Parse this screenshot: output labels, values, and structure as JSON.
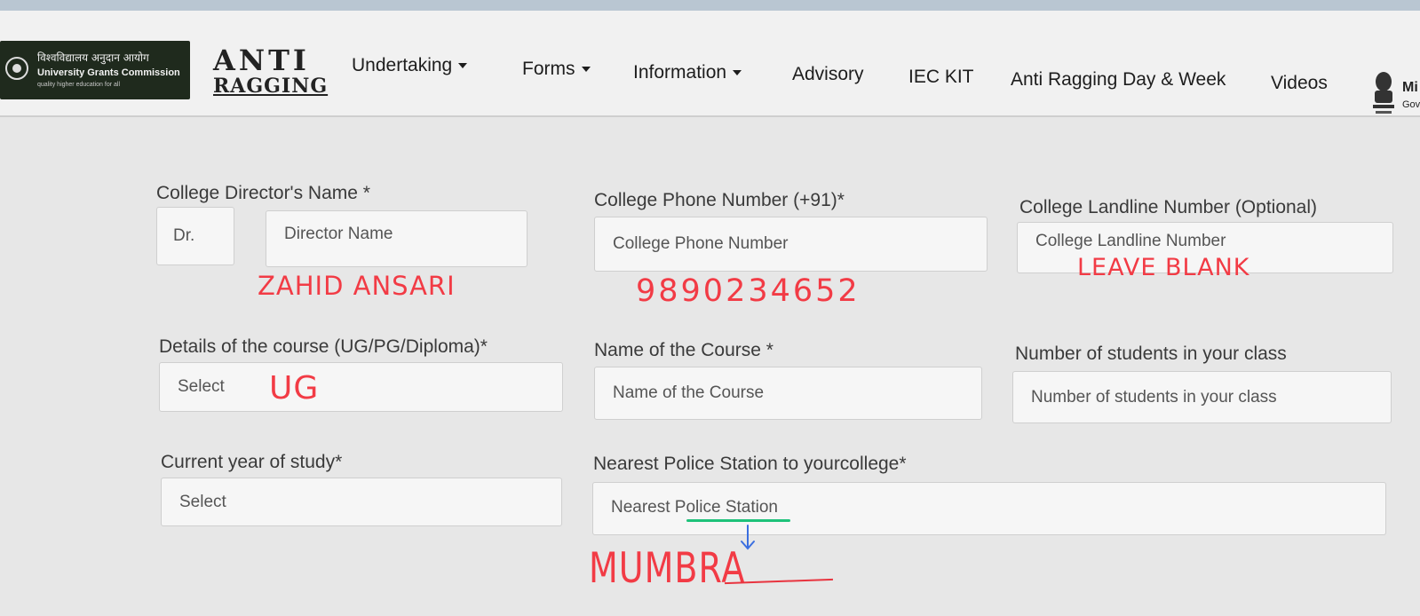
{
  "brand": {
    "ugc_hindi": "विश्वविद्यालय अनुदान आयोग",
    "ugc_name": "University Grants Commission",
    "ugc_tagline": "quality higher education for all",
    "anti": "ANTI",
    "ragging": "RAGGING"
  },
  "nav": {
    "items": [
      "Undertaking",
      "Forms",
      "Information",
      "Advisory",
      "IEC KIT",
      "Anti Ragging Day & Week",
      "Videos"
    ],
    "emblem_text": "Mi",
    "emblem_text2": "Gov"
  },
  "form": {
    "director_label": "College Director's Name *",
    "director_prefix": "Dr.",
    "director_placeholder": "Director Name",
    "phone_label": "College Phone Number (+91)*",
    "phone_placeholder": "College Phone Number",
    "landline_label": "College Landline Number (Optional)",
    "landline_placeholder": "College Landline Number",
    "course_details_label": "Details of the course (UG/PG/Diploma)*",
    "course_details_value": "Select",
    "course_name_label": "Name of the Course *",
    "course_name_placeholder": "Name of the Course",
    "students_label": "Number of students in your class",
    "students_placeholder": "Number of students in your class",
    "year_label": "Current year of study*",
    "year_value": "Select",
    "police_label": "Nearest Police Station to yourcollege*",
    "police_placeholder": "Nearest Police Station"
  },
  "annotations": {
    "director_name": "ZAHID ANSARI",
    "phone": "9890234652",
    "landline": "LEAVE BLANK",
    "course": "UG",
    "police": "MUMBRA"
  },
  "colors": {
    "handwriting": "#f23b45",
    "highlight": "#1ec27a",
    "arrow": "#3b6fe0"
  }
}
